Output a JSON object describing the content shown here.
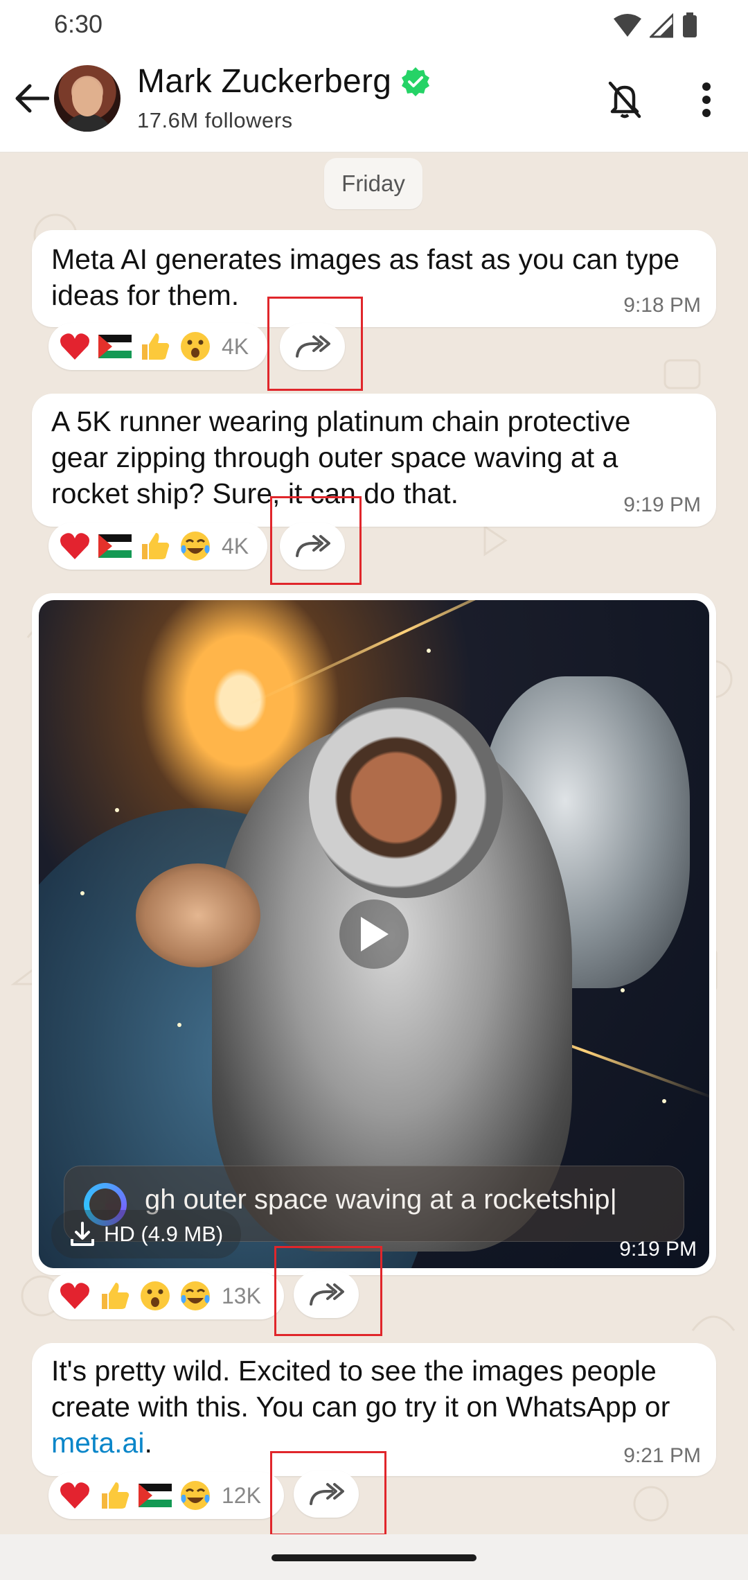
{
  "status_bar": {
    "time": "6:30"
  },
  "header": {
    "channel_name": "Mark Zuckerberg",
    "followers": "17.6M followers",
    "back_icon": "arrow-left-icon",
    "verified_icon": "verified-badge-icon",
    "mute_icon": "bell-off-icon",
    "menu_icon": "more-vertical-icon"
  },
  "date_divider": "Friday",
  "messages": [
    {
      "text": "Meta AI generates images as fast as you can type ideas for them.",
      "time": "9:18 PM",
      "reactions": [
        "red-heart",
        "palestine-flag",
        "thumbs-up",
        "surprised-face"
      ],
      "reaction_count": "4K"
    },
    {
      "text": "A 5K runner wearing platinum chain protective gear zipping through outer space waving at a rocket ship? Sure, it can do that.",
      "time": "9:19 PM",
      "reactions": [
        "red-heart",
        "palestine-flag",
        "thumbs-up",
        "tears-of-joy"
      ],
      "reaction_count": "4K"
    },
    {
      "video_prompt": "gh outer space waving at a rocketship|",
      "video_quality": "HD (4.9 MB)",
      "time": "9:19 PM",
      "reactions": [
        "red-heart",
        "thumbs-up",
        "surprised-face",
        "tears-of-joy"
      ],
      "reaction_count": "13K"
    },
    {
      "text_before_link": "It's pretty wild. Excited to see the images people create with this. You can go try it on WhatsApp or ",
      "link": "meta.ai",
      "text_after_link": ".",
      "time": "9:21 PM",
      "reactions": [
        "red-heart",
        "thumbs-up",
        "palestine-flag",
        "tears-of-joy"
      ],
      "reaction_count": "12K"
    }
  ],
  "colors": {
    "wallpaper": "#efe7de",
    "bubble": "#ffffff",
    "link": "#0a86c9",
    "verified": "#25d366",
    "highlight": "#e0262b"
  }
}
